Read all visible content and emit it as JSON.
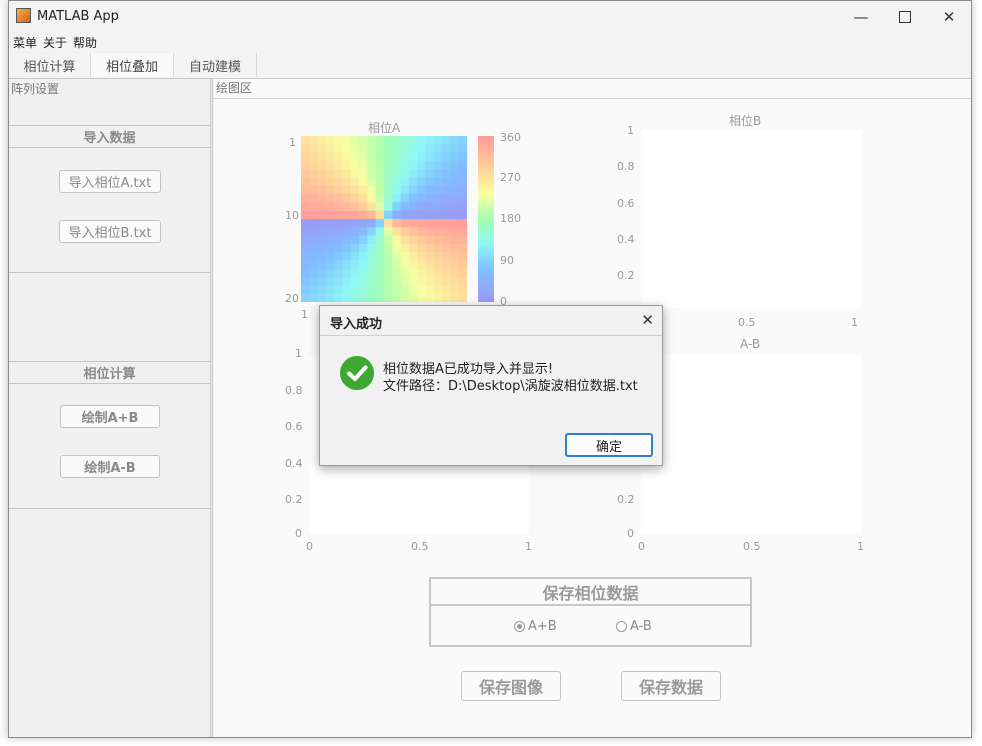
{
  "window": {
    "title": "MATLAB App"
  },
  "menu": {
    "items": [
      "菜单",
      "关于",
      "帮助"
    ]
  },
  "tabs": [
    "相位计算",
    "相位叠加",
    "自动建模"
  ],
  "left_panel": {
    "title": "阵列设置",
    "import": {
      "header": "导入数据",
      "btn_a": "导入相位A.txt",
      "btn_b": "导入相位B.txt"
    },
    "compute": {
      "header": "相位计算",
      "btn_sum": "绘制A+B",
      "btn_diff": "绘制A-B"
    }
  },
  "plot_panel": {
    "title": "绘图区",
    "axes": {
      "a": {
        "title": "相位A",
        "yticks": [
          "1",
          "10",
          "20"
        ],
        "xticks": [
          "1"
        ],
        "colorbar": [
          "360",
          "270",
          "180",
          "90",
          "0"
        ]
      },
      "b": {
        "title": "相位B",
        "yticks": [
          "1",
          "0.8",
          "0.6",
          "0.4",
          "0.2"
        ],
        "xticks": [
          "0.5",
          "1"
        ]
      },
      "sum": {
        "yticks": [
          "1",
          "0.8",
          "0.6",
          "0.4",
          "0.2",
          "0"
        ],
        "xticks": [
          "0",
          "0.5",
          "1"
        ]
      },
      "diff": {
        "title": "A-B",
        "yticks": [
          "0.2",
          "0"
        ],
        "xticks": [
          "0",
          "0.5",
          "1"
        ]
      }
    },
    "save_group": {
      "header": "保存相位数据",
      "radio_sum": "A+B",
      "radio_diff": "A-B",
      "selected": "A+B"
    },
    "save_image": "保存图像",
    "save_data": "保存数据"
  },
  "dialog": {
    "title": "导入成功",
    "line1": "相位数据A已成功导入并显示!",
    "line2": "文件路径：D:\\Desktop\\涡旋波相位数据.txt",
    "ok": "确定"
  },
  "colors": {
    "accent": "#2f7fd6",
    "success": "#3ea833"
  }
}
